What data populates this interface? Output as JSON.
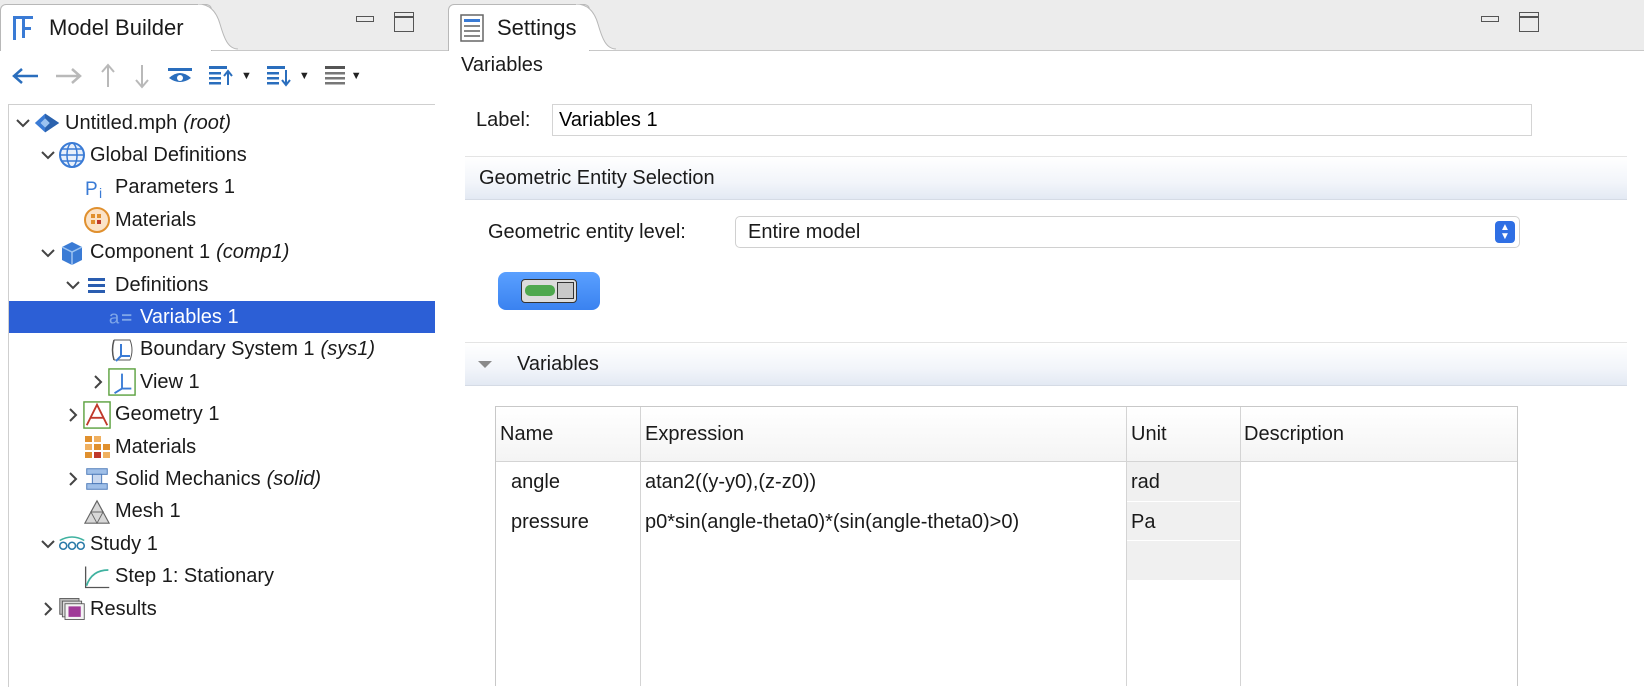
{
  "model_builder": {
    "tab_title": "Model Builder",
    "toolbar": [
      {
        "name": "back-button",
        "icon": "arrow-left-icon",
        "enabled": true
      },
      {
        "name": "forward-button",
        "icon": "arrow-right-icon",
        "enabled": false
      },
      {
        "name": "move-up-button",
        "icon": "arrow-up-icon",
        "enabled": false
      },
      {
        "name": "move-down-button",
        "icon": "arrow-down-icon",
        "enabled": false
      },
      {
        "name": "show-button",
        "icon": "eye-icon",
        "enabled": true
      },
      {
        "name": "expand-sections-button",
        "icon": "list-up-icon",
        "enabled": true,
        "dropdown": true
      },
      {
        "name": "collapse-sections-button",
        "icon": "list-down-icon",
        "enabled": true,
        "dropdown": true
      },
      {
        "name": "view-options-button",
        "icon": "list-icon",
        "enabled": true,
        "dropdown": true
      }
    ],
    "tree": [
      {
        "label": "Untitled.mph",
        "suffix": "(root)",
        "level": 0,
        "toggle": "expanded",
        "icon": "model-root-icon"
      },
      {
        "label": "Global Definitions",
        "suffix": "",
        "level": 1,
        "toggle": "expanded",
        "icon": "globe-icon"
      },
      {
        "label": "Parameters 1",
        "suffix": "",
        "level": 2,
        "toggle": "none",
        "icon": "parameters-icon"
      },
      {
        "label": "Materials",
        "suffix": "",
        "level": 2,
        "toggle": "none",
        "icon": "materials-icon"
      },
      {
        "label": "Component 1",
        "suffix": "(comp1)",
        "level": 1,
        "toggle": "expanded",
        "icon": "component-cube-icon"
      },
      {
        "label": "Definitions",
        "suffix": "",
        "level": 2,
        "toggle": "expanded",
        "icon": "definitions-icon"
      },
      {
        "label": "Variables 1",
        "suffix": "",
        "level": 3,
        "toggle": "none",
        "icon": "variables-icon",
        "selected": true
      },
      {
        "label": "Boundary System 1",
        "suffix": "(sys1)",
        "level": 3,
        "toggle": "none",
        "icon": "coordinate-system-icon"
      },
      {
        "label": "View 1",
        "suffix": "",
        "level": 3,
        "toggle": "collapsed",
        "icon": "view-icon"
      },
      {
        "label": "Geometry 1",
        "suffix": "",
        "level": 2,
        "toggle": "collapsed",
        "icon": "geometry-icon"
      },
      {
        "label": "Materials",
        "suffix": "",
        "level": 2,
        "toggle": "none",
        "icon": "materials-grid-icon"
      },
      {
        "label": "Solid Mechanics",
        "suffix": "(solid)",
        "level": 2,
        "toggle": "collapsed",
        "icon": "solid-mechanics-icon"
      },
      {
        "label": "Mesh 1",
        "suffix": "",
        "level": 2,
        "toggle": "none",
        "icon": "mesh-icon"
      },
      {
        "label": "Study 1",
        "suffix": "",
        "level": 1,
        "toggle": "expanded",
        "icon": "study-icon"
      },
      {
        "label": "Step 1: Stationary",
        "suffix": "",
        "level": 2,
        "toggle": "none",
        "icon": "stationary-step-icon"
      },
      {
        "label": "Results",
        "suffix": "",
        "level": 1,
        "toggle": "collapsed",
        "icon": "results-icon"
      }
    ]
  },
  "settings": {
    "tab_title": "Settings",
    "section_title": "Variables",
    "label_caption": "Label:",
    "label_value": "Variables 1",
    "geometric_section_title": "Geometric Entity Selection",
    "geometric_level_caption": "Geometric entity level:",
    "geometric_level_value": "Entire model",
    "variables_section_title": "Variables",
    "table": {
      "columns": [
        "Name",
        "Expression",
        "Unit",
        "Description"
      ],
      "rows": [
        {
          "name": "angle",
          "expression": "atan2((y-y0),(z-z0))",
          "unit": "rad",
          "description": ""
        },
        {
          "name": "pressure",
          "expression": "p0*sin(angle-theta0)*(sin(angle-theta0)>0)",
          "unit": "Pa",
          "description": ""
        }
      ]
    }
  },
  "colors": {
    "selection": "#2c5fd6",
    "accent": "#2f6fe4",
    "toggle_on": "#4ea84e"
  }
}
